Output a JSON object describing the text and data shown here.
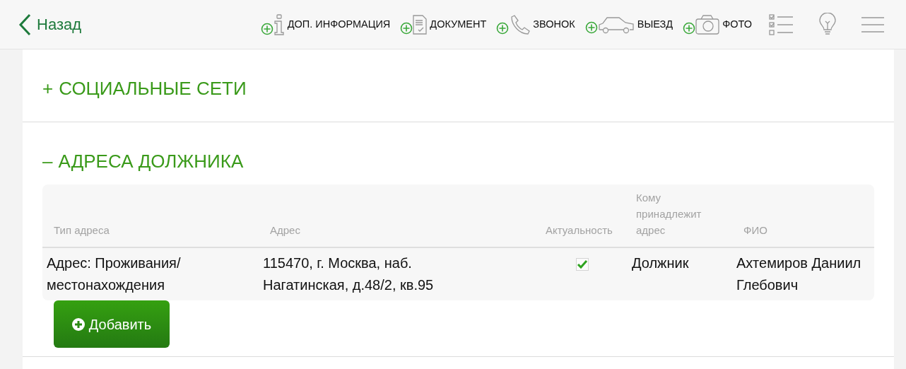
{
  "back": {
    "label": "Назад"
  },
  "toolbar": [
    {
      "kind": "info",
      "label": "ДОП. ИНФОРМАЦИЯ"
    },
    {
      "kind": "document",
      "label": "ДОКУМЕНТ"
    },
    {
      "kind": "call",
      "label": "ЗВОНОК"
    },
    {
      "kind": "trip",
      "label": "ВЫЕЗД"
    },
    {
      "kind": "photo",
      "label": "ФОТО"
    },
    {
      "kind": "checklist"
    },
    {
      "kind": "idea"
    },
    {
      "kind": "menu"
    }
  ],
  "sections": [
    {
      "sign": "+",
      "title": "СОЦИАЛЬНЫЕ СЕТИ"
    },
    {
      "sign": "–",
      "title": "АДРЕСА ДОЛЖНИКА",
      "table": {
        "columns": [
          "Тип адреса",
          "Адрес",
          "Актуальность",
          "Кому принадлежит адрес",
          "ФИО"
        ],
        "rows": [
          {
            "type": "Адрес: Проживания/ местонахождения",
            "address": "115470, г. Москва, наб. Нагатинская, д.48/2, кв.95",
            "actual": true,
            "owner": "Должник",
            "name": "Ахтемиров Даниил Глебович"
          }
        ]
      },
      "add_button": "Добавить"
    }
  ]
}
